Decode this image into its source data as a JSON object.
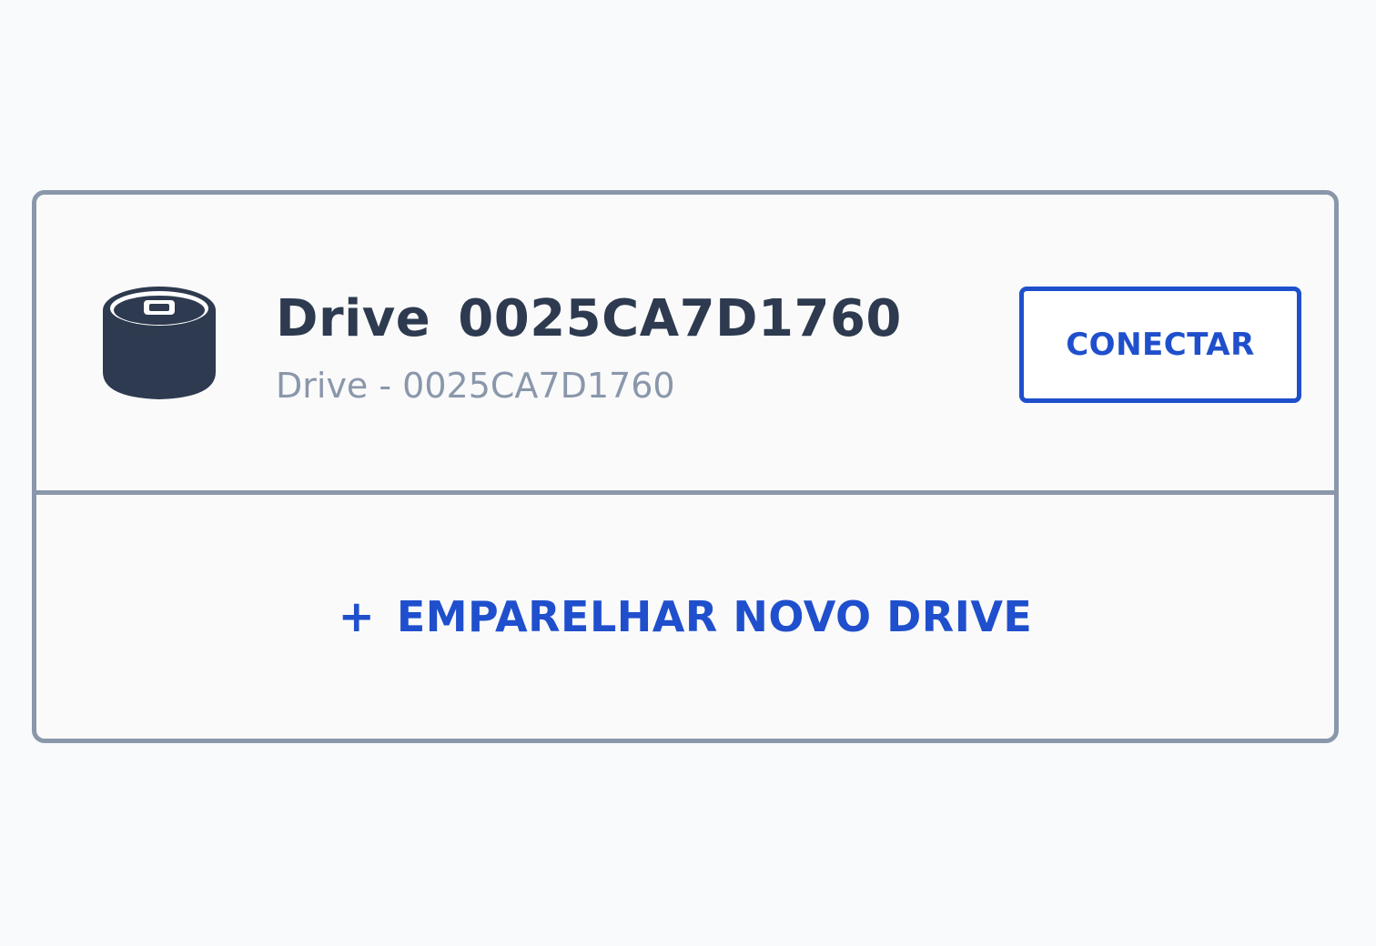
{
  "drive": {
    "icon": "drive-cylinder-icon",
    "title": "Drive  0025CA7D1760",
    "subtitle": "Drive - 0025CA7D1760",
    "connect_label": "CONECTAR"
  },
  "pair": {
    "icon": "plus-icon",
    "plus": "+",
    "label": "EMPARELHAR NOVO DRIVE"
  },
  "colors": {
    "accent": "#1f4fcc",
    "border": "#8a97ab",
    "title": "#2d3a4f",
    "subtitle": "#8a97ab",
    "background": "#f9fafb"
  }
}
